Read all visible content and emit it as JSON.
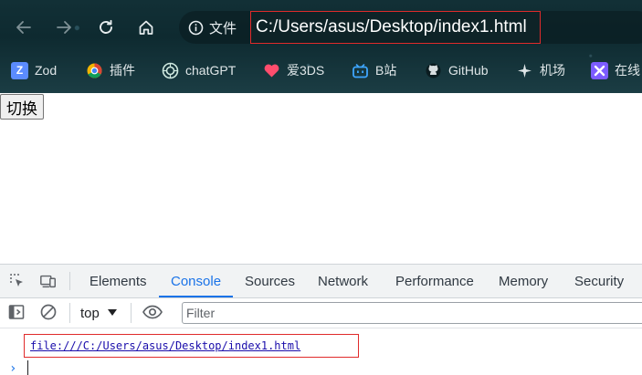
{
  "browser": {
    "site_info_label": "文件",
    "url": "C:/Users/asus/Desktop/index1.html",
    "bookmarks": [
      {
        "label": "Zod",
        "icon": "zod-icon",
        "glyph": "Z",
        "color": "#5b8cff"
      },
      {
        "label": "插件",
        "icon": "extension-store-icon",
        "glyph": "",
        "color": "#f0a030"
      },
      {
        "label": "chatGPT",
        "icon": "openai-icon",
        "glyph": "",
        "color": "#10a37f"
      },
      {
        "label": "爱3DS",
        "icon": "heart-icon",
        "glyph": "",
        "color": "#ff4d6d"
      },
      {
        "label": "B站",
        "icon": "bilibili-icon",
        "glyph": "",
        "color": "#1e90ff"
      },
      {
        "label": "GitHub",
        "icon": "github-icon",
        "glyph": "",
        "color": "#1b1f23"
      },
      {
        "label": "机场",
        "icon": "sparkle-icon",
        "glyph": "",
        "color": "#9aa7ad"
      },
      {
        "label": "在线",
        "icon": "x-logo-icon",
        "glyph": "",
        "color": "#7c5cff"
      }
    ]
  },
  "page": {
    "toggle_button_label": "切换"
  },
  "devtools": {
    "tabs": [
      {
        "label": "Elements",
        "active": false
      },
      {
        "label": "Console",
        "active": true
      },
      {
        "label": "Sources",
        "active": false
      },
      {
        "label": "Network",
        "active": false
      },
      {
        "label": "Performance",
        "active": false
      },
      {
        "label": "Memory",
        "active": false
      },
      {
        "label": "Security",
        "active": false
      }
    ],
    "context_selector": "top",
    "filter_placeholder": "Filter",
    "console_output": "file:///C:/Users/asus/Desktop/index1.html",
    "prompt_symbol": "›"
  },
  "colors": {
    "accent": "#1a73e8",
    "highlight_box": "#e02b2b",
    "chrome_background": "#123036"
  }
}
